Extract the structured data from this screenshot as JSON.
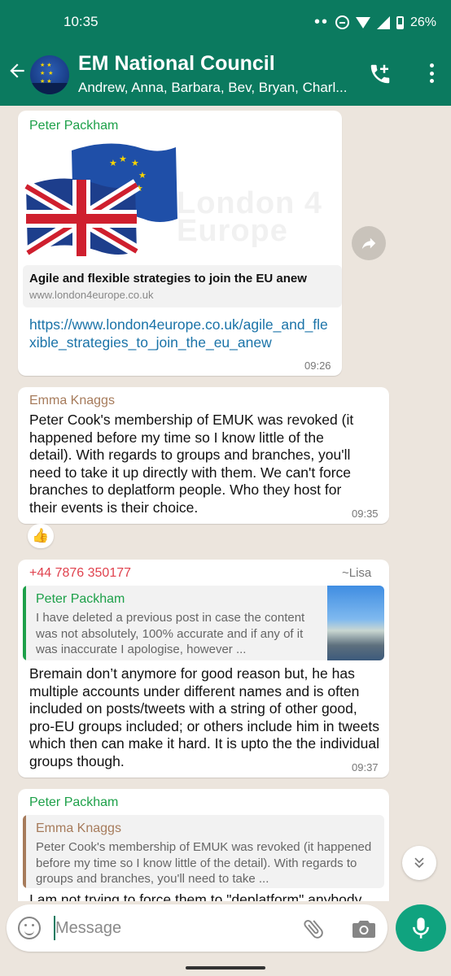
{
  "status_bar": {
    "time": "10:35",
    "battery": "26%"
  },
  "header": {
    "title": "EM National Council",
    "subtitle": "Andrew, Anna, Barbara, Bev, Bryan, Charl..."
  },
  "messages": [
    {
      "sender": "Peter Packham",
      "preview_image_text": "London 4 Europe",
      "link_title": "Agile and flexible strategies to join the EU anew",
      "link_domain": "www.london4europe.co.uk",
      "link_url": "https://www.london4europe.co.uk/agile_and_flexible_strategies_to_join_the_eu_anew",
      "time": "09:26"
    },
    {
      "sender": "Emma Knaggs",
      "text": "Peter Cook's membership of EMUK was revoked (it happened before my time so I know little of the detail).  With regards to groups and branches, you'll need to take it up directly with them. We can't force branches to deplatform people. Who they host for their events is their choice.",
      "time": "09:35",
      "reaction": "👍"
    },
    {
      "sender": "+44 7876 350177",
      "sender_alias": "~Lisa",
      "quote_sender": "Peter Packham",
      "quote_text": "I have deleted a previous post in case the content was not absolutely, 100% accurate and if any of it was inaccurate I apologise, however ...",
      "text": "Bremain don’t anymore for good reason but, he has multiple accounts under different names and is often included on posts/tweets with a string of other good, pro-EU groups included; or others include him in tweets which then can make it hard. It is upto the the individual groups though.",
      "time": "09:37"
    },
    {
      "sender": "Peter Packham",
      "quote_sender": "Emma Knaggs",
      "quote_text": "Peter Cook's membership of EMUK was revoked (it happened before my time so I know little of the detail). With regards to groups and branches, you'll need to take ...",
      "text": "I am not trying to force them to \"deplatform\" anybody"
    }
  ],
  "input": {
    "placeholder": "Message"
  },
  "colors": {
    "header": "#0b7a5f",
    "accent": "#10a37f",
    "chat_bg": "#ece5dd",
    "name_green": "#1da049",
    "name_brown": "#a67b5b",
    "name_red": "#e0424e",
    "link": "#1a73a8"
  }
}
